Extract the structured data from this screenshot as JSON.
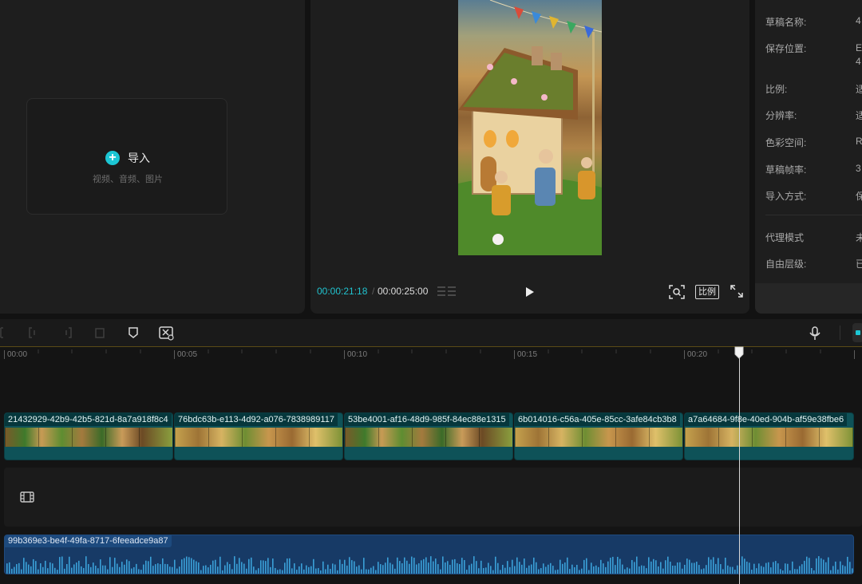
{
  "media_panel": {
    "import_label": "导入",
    "import_hint": "视频、音频、图片"
  },
  "player": {
    "current_time": "00:00:21:18",
    "total_time": "00:00:25:00",
    "ratio_label": "比例"
  },
  "draft_info": {
    "rows": [
      {
        "label": "草稿名称:",
        "value": "4"
      },
      {
        "label": "保存位置:",
        "value": "E\n4"
      },
      {
        "label": "比例:",
        "value": "适"
      },
      {
        "label": "分辨率:",
        "value": "适"
      },
      {
        "label": "色彩空间:",
        "value": "R"
      },
      {
        "label": "草稿帧率:",
        "value": "3"
      },
      {
        "label": "导入方式:",
        "value": "保"
      }
    ],
    "rows2": [
      {
        "label": "代理模式",
        "value": "未"
      },
      {
        "label": "自由层级:",
        "value": "已"
      }
    ]
  },
  "timeline": {
    "ruler_ticks": [
      "00:00",
      "00:05",
      "00:10",
      "00:15",
      "00:20"
    ],
    "video_clips": [
      {
        "name": "21432929-42b9-42b5-821d-8a7a918f8c4"
      },
      {
        "name": "76bdc63b-e113-4d92-a076-7838989117"
      },
      {
        "name": "53be4001-af16-48d9-985f-84ec88e1315"
      },
      {
        "name": "6b014016-c56a-405e-85cc-3afe84cb3b8"
      },
      {
        "name": "a7a64684-9f8e-40ed-904b-af59e38fbe6"
      }
    ],
    "audio_clip": {
      "name": "99b369e3-be4f-49fa-8717-6feeadce9a87"
    }
  },
  "colors": {
    "accent": "#1cc6d4",
    "video_clip": "#0e5258",
    "audio_clip": "#173a66"
  }
}
